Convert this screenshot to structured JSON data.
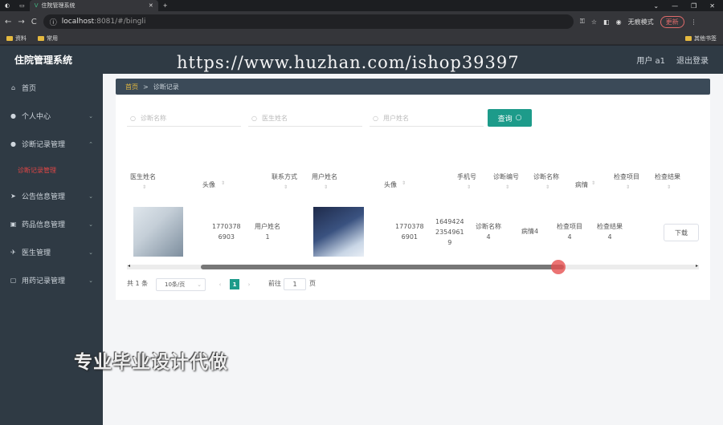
{
  "browser": {
    "tab_title": "住院管理系统",
    "new_tab": "+",
    "window_controls": [
      "⌄",
      "—",
      "❐",
      "✕"
    ],
    "url_host": "localhost",
    "url_path": ":8081/#/bingli",
    "incognito": "无痕模式",
    "update": "更新",
    "bookmarks": [
      "资料",
      "常用"
    ],
    "other_bookmarks": "其他书签"
  },
  "app": {
    "title": "住院管理系统",
    "user": "用户 a1",
    "logout": "退出登录"
  },
  "watermark": "https://www.huzhan.com/ishop39397",
  "sidebar": {
    "items": [
      {
        "label": "首页",
        "icon": "home-icon"
      },
      {
        "label": "个人中心",
        "icon": "person-icon"
      },
      {
        "label": "诊断记录管理",
        "icon": "person-icon"
      },
      {
        "label": "诊断记录管理"
      },
      {
        "label": "公告信息管理",
        "icon": "send-icon"
      },
      {
        "label": "药品信息管理",
        "icon": "box-icon"
      },
      {
        "label": "医生管理",
        "icon": "plane-icon"
      },
      {
        "label": "用药记录管理",
        "icon": "chat-icon"
      }
    ]
  },
  "breadcrumb": {
    "home": "首页",
    "sep": ">",
    "current": "诊断记录"
  },
  "search": {
    "p1": "诊断名称",
    "p2": "医生姓名",
    "p3": "用户姓名",
    "button": "查询"
  },
  "table": {
    "headers": [
      "医生姓名",
      "头像",
      "联系方式",
      "用户姓名",
      "头像",
      "手机号",
      "诊断编号",
      "诊断名称",
      "病情",
      "检查项目",
      "检查结果"
    ],
    "row": {
      "phone1a": "1770378",
      "phone1b": "6903",
      "user_a": "用户姓名",
      "user_b": "1",
      "phone2a": "1770378",
      "phone2b": "6901",
      "code_a": "1649424",
      "code_b": "2354961",
      "code_c": "9",
      "diag_a": "诊断名称",
      "diag_b": "4",
      "cond": "病情4",
      "check_a": "检查项目",
      "check_b": "4",
      "result_a": "检查结果",
      "result_b": "4",
      "download": "下载"
    }
  },
  "pagination": {
    "total": "共 1 条",
    "size": "10条/页",
    "page": "1",
    "goto": "前往",
    "goto_value": "1",
    "page_unit": "页"
  },
  "ad_text": "专业毕业设计代做"
}
